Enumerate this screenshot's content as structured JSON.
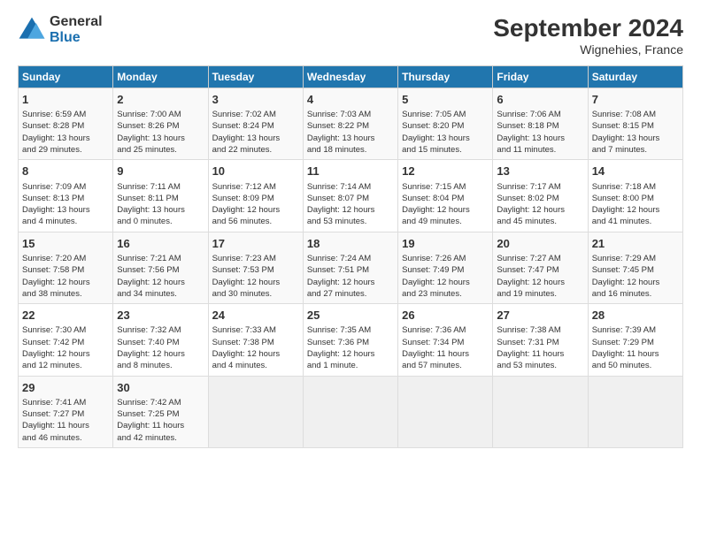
{
  "header": {
    "logo_line1": "General",
    "logo_line2": "Blue",
    "title": "September 2024",
    "subtitle": "Wignehies, France"
  },
  "days_of_week": [
    "Sunday",
    "Monday",
    "Tuesday",
    "Wednesday",
    "Thursday",
    "Friday",
    "Saturday"
  ],
  "weeks": [
    [
      {
        "day": "1",
        "lines": [
          "Sunrise: 6:59 AM",
          "Sunset: 8:28 PM",
          "Daylight: 13 hours",
          "and 29 minutes."
        ]
      },
      {
        "day": "2",
        "lines": [
          "Sunrise: 7:00 AM",
          "Sunset: 8:26 PM",
          "Daylight: 13 hours",
          "and 25 minutes."
        ]
      },
      {
        "day": "3",
        "lines": [
          "Sunrise: 7:02 AM",
          "Sunset: 8:24 PM",
          "Daylight: 13 hours",
          "and 22 minutes."
        ]
      },
      {
        "day": "4",
        "lines": [
          "Sunrise: 7:03 AM",
          "Sunset: 8:22 PM",
          "Daylight: 13 hours",
          "and 18 minutes."
        ]
      },
      {
        "day": "5",
        "lines": [
          "Sunrise: 7:05 AM",
          "Sunset: 8:20 PM",
          "Daylight: 13 hours",
          "and 15 minutes."
        ]
      },
      {
        "day": "6",
        "lines": [
          "Sunrise: 7:06 AM",
          "Sunset: 8:18 PM",
          "Daylight: 13 hours",
          "and 11 minutes."
        ]
      },
      {
        "day": "7",
        "lines": [
          "Sunrise: 7:08 AM",
          "Sunset: 8:15 PM",
          "Daylight: 13 hours",
          "and 7 minutes."
        ]
      }
    ],
    [
      {
        "day": "8",
        "lines": [
          "Sunrise: 7:09 AM",
          "Sunset: 8:13 PM",
          "Daylight: 13 hours",
          "and 4 minutes."
        ]
      },
      {
        "day": "9",
        "lines": [
          "Sunrise: 7:11 AM",
          "Sunset: 8:11 PM",
          "Daylight: 13 hours",
          "and 0 minutes."
        ]
      },
      {
        "day": "10",
        "lines": [
          "Sunrise: 7:12 AM",
          "Sunset: 8:09 PM",
          "Daylight: 12 hours",
          "and 56 minutes."
        ]
      },
      {
        "day": "11",
        "lines": [
          "Sunrise: 7:14 AM",
          "Sunset: 8:07 PM",
          "Daylight: 12 hours",
          "and 53 minutes."
        ]
      },
      {
        "day": "12",
        "lines": [
          "Sunrise: 7:15 AM",
          "Sunset: 8:04 PM",
          "Daylight: 12 hours",
          "and 49 minutes."
        ]
      },
      {
        "day": "13",
        "lines": [
          "Sunrise: 7:17 AM",
          "Sunset: 8:02 PM",
          "Daylight: 12 hours",
          "and 45 minutes."
        ]
      },
      {
        "day": "14",
        "lines": [
          "Sunrise: 7:18 AM",
          "Sunset: 8:00 PM",
          "Daylight: 12 hours",
          "and 41 minutes."
        ]
      }
    ],
    [
      {
        "day": "15",
        "lines": [
          "Sunrise: 7:20 AM",
          "Sunset: 7:58 PM",
          "Daylight: 12 hours",
          "and 38 minutes."
        ]
      },
      {
        "day": "16",
        "lines": [
          "Sunrise: 7:21 AM",
          "Sunset: 7:56 PM",
          "Daylight: 12 hours",
          "and 34 minutes."
        ]
      },
      {
        "day": "17",
        "lines": [
          "Sunrise: 7:23 AM",
          "Sunset: 7:53 PM",
          "Daylight: 12 hours",
          "and 30 minutes."
        ]
      },
      {
        "day": "18",
        "lines": [
          "Sunrise: 7:24 AM",
          "Sunset: 7:51 PM",
          "Daylight: 12 hours",
          "and 27 minutes."
        ]
      },
      {
        "day": "19",
        "lines": [
          "Sunrise: 7:26 AM",
          "Sunset: 7:49 PM",
          "Daylight: 12 hours",
          "and 23 minutes."
        ]
      },
      {
        "day": "20",
        "lines": [
          "Sunrise: 7:27 AM",
          "Sunset: 7:47 PM",
          "Daylight: 12 hours",
          "and 19 minutes."
        ]
      },
      {
        "day": "21",
        "lines": [
          "Sunrise: 7:29 AM",
          "Sunset: 7:45 PM",
          "Daylight: 12 hours",
          "and 16 minutes."
        ]
      }
    ],
    [
      {
        "day": "22",
        "lines": [
          "Sunrise: 7:30 AM",
          "Sunset: 7:42 PM",
          "Daylight: 12 hours",
          "and 12 minutes."
        ]
      },
      {
        "day": "23",
        "lines": [
          "Sunrise: 7:32 AM",
          "Sunset: 7:40 PM",
          "Daylight: 12 hours",
          "and 8 minutes."
        ]
      },
      {
        "day": "24",
        "lines": [
          "Sunrise: 7:33 AM",
          "Sunset: 7:38 PM",
          "Daylight: 12 hours",
          "and 4 minutes."
        ]
      },
      {
        "day": "25",
        "lines": [
          "Sunrise: 7:35 AM",
          "Sunset: 7:36 PM",
          "Daylight: 12 hours",
          "and 1 minute."
        ]
      },
      {
        "day": "26",
        "lines": [
          "Sunrise: 7:36 AM",
          "Sunset: 7:34 PM",
          "Daylight: 11 hours",
          "and 57 minutes."
        ]
      },
      {
        "day": "27",
        "lines": [
          "Sunrise: 7:38 AM",
          "Sunset: 7:31 PM",
          "Daylight: 11 hours",
          "and 53 minutes."
        ]
      },
      {
        "day": "28",
        "lines": [
          "Sunrise: 7:39 AM",
          "Sunset: 7:29 PM",
          "Daylight: 11 hours",
          "and 50 minutes."
        ]
      }
    ],
    [
      {
        "day": "29",
        "lines": [
          "Sunrise: 7:41 AM",
          "Sunset: 7:27 PM",
          "Daylight: 11 hours",
          "and 46 minutes."
        ]
      },
      {
        "day": "30",
        "lines": [
          "Sunrise: 7:42 AM",
          "Sunset: 7:25 PM",
          "Daylight: 11 hours",
          "and 42 minutes."
        ]
      },
      {
        "day": "",
        "lines": []
      },
      {
        "day": "",
        "lines": []
      },
      {
        "day": "",
        "lines": []
      },
      {
        "day": "",
        "lines": []
      },
      {
        "day": "",
        "lines": []
      }
    ]
  ]
}
